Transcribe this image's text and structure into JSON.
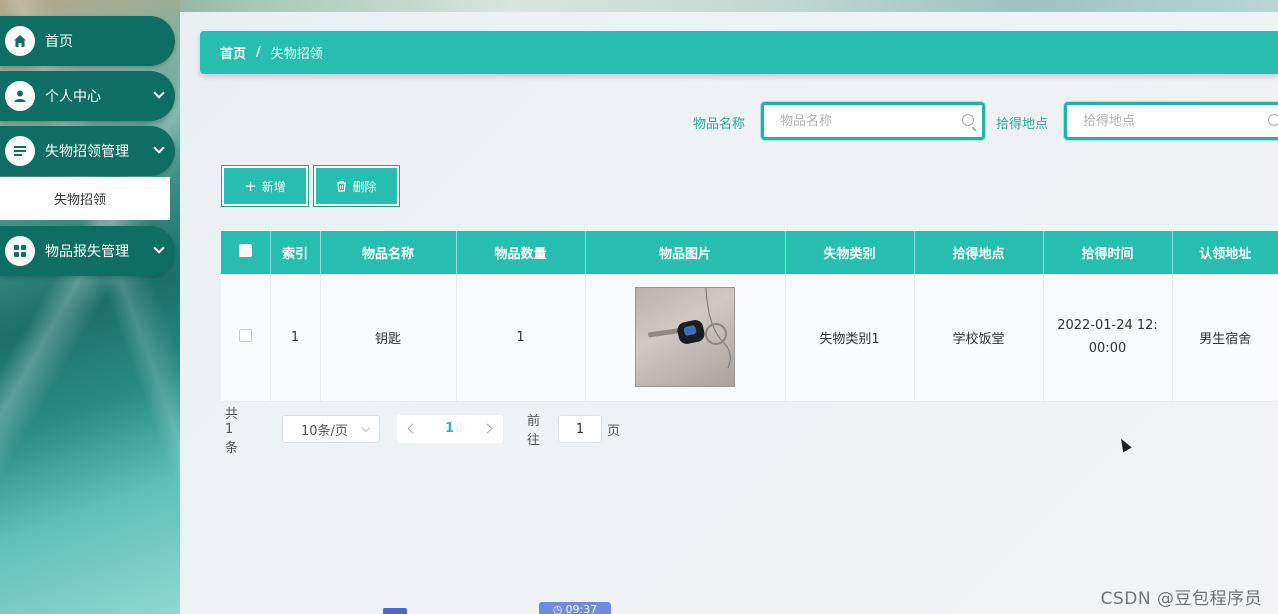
{
  "sidebar": {
    "items": [
      {
        "label": "首页",
        "icon": "home-icon"
      },
      {
        "label": "个人中心",
        "icon": "user-icon"
      },
      {
        "label": "失物招领管理",
        "icon": "list-icon"
      },
      {
        "label": "物品报失管理",
        "icon": "grid-icon"
      }
    ],
    "sub_item": "失物招领"
  },
  "breadcrumb": {
    "home": "首页",
    "separator": "/",
    "current": "失物招领"
  },
  "search": {
    "item_name_label": "物品名称",
    "item_name_placeholder": "物品名称",
    "location_label": "拾得地点",
    "location_placeholder": "拾得地点"
  },
  "toolbar": {
    "add_label": "新增",
    "delete_label": "删除"
  },
  "table": {
    "headers": [
      "索引",
      "物品名称",
      "物品数量",
      "物品图片",
      "失物类别",
      "拾得地点",
      "拾得时间",
      "认领地址"
    ],
    "rows": [
      {
        "index": "1",
        "name": "钥匙",
        "quantity": "1",
        "image": "keys-photo",
        "category": "失物类别1",
        "location": "学校饭堂",
        "time_line1": "2022-01-24 12:",
        "time_line2": "00:00",
        "address": "男生宿舍"
      }
    ]
  },
  "pagination": {
    "total_label": "共 1 条",
    "page_size": "10条/页",
    "current_page": "1",
    "goto_label": "前往",
    "goto_value": "1",
    "page_suffix": "页"
  },
  "timer": "09:37",
  "watermark": "CSDN @豆包程序员",
  "colors": {
    "accent": "#27beb0",
    "sidebar_item": "#0f6e63"
  }
}
